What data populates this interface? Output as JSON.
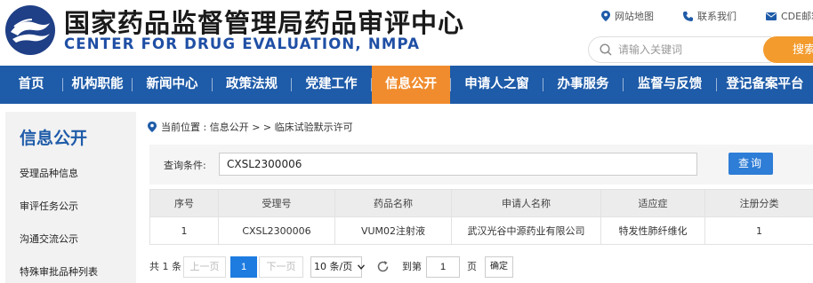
{
  "header": {
    "title_cn": "国家药品监督管理局药品审评中心",
    "title_en": "CENTER FOR DRUG EVALUATION, NMPA",
    "logo_icon": "cde-logo-icon",
    "links": [
      {
        "label": "网站地图",
        "icon": "location-pin-icon"
      },
      {
        "label": "联系我们",
        "icon": "phone-icon"
      },
      {
        "label": "CDE邮箱",
        "icon": "mail-icon"
      }
    ],
    "search": {
      "placeholder": "请输入关键词",
      "value": "",
      "button_label": "搜索"
    }
  },
  "nav": {
    "items": [
      "首页",
      "机构职能",
      "新闻中心",
      "政策法规",
      "党建工作",
      "信息公开",
      "申请人之窗",
      "办事服务",
      "监督与反馈",
      "登记备案平台"
    ],
    "active": "信息公开",
    "colors": {
      "bar": "#1e5ba8",
      "active": "#f08c2e"
    }
  },
  "sidebar": {
    "title": "信息公开",
    "items": [
      "受理品种信息",
      "审评任务公示",
      "沟通交流公示",
      "特殊审批品种列表"
    ]
  },
  "breadcrumb": {
    "text": "当前位置 : 信息公开 > > 临床试验默示许可"
  },
  "query": {
    "label": "查询条件:",
    "value": "CXSL2300006",
    "button_label": "查询"
  },
  "table": {
    "headers": [
      "序号",
      "受理号",
      "药品名称",
      "申请人名称",
      "适应症",
      "注册分类"
    ],
    "rows": [
      [
        "1",
        "CXSL2300006",
        "VUM02注射液",
        "武汉光谷中源药业有限公司",
        "特发性肺纤维化",
        "1"
      ]
    ]
  },
  "pagination": {
    "total": "共 1 条",
    "prev": "上一页",
    "current": "1",
    "next": "下一页",
    "page_size": "10 条/页",
    "goto_label": "到第",
    "goto_value": "1",
    "page_label": "页",
    "confirm": "确定"
  }
}
